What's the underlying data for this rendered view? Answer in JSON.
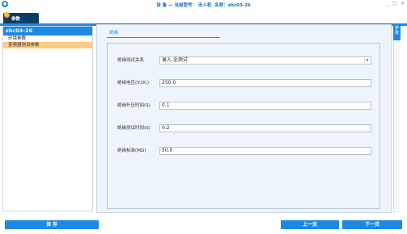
{
  "window": {
    "logo": "logo-icon",
    "title": "设 备 — 当前型号： 无人机  名称：zhc03-26",
    "controls": [
      "_",
      "□",
      "✕"
    ]
  },
  "tabs": {
    "params_label": "参数"
  },
  "sidebar": {
    "header": "zhc03-26",
    "items": [
      {
        "label": "环境参数",
        "active": false
      },
      {
        "label": "变频器测试参数",
        "active": true
      }
    ]
  },
  "main": {
    "section_title": "绝缘",
    "fields": [
      {
        "label": "绝缘测试关系",
        "value": "录入.全测试",
        "type": "select"
      },
      {
        "label": "绝缘电压(V.DC)",
        "value": "250.0",
        "type": "text"
      },
      {
        "label": "绝缘升压时间(S)",
        "value": "0.1",
        "type": "text"
      },
      {
        "label": "绝缘测试时间(S)",
        "value": "0.2",
        "type": "text"
      },
      {
        "label": "绝缘标准(MΩ)",
        "value": "50.0",
        "type": "text"
      }
    ]
  },
  "right_tab": {
    "label": "参数"
  },
  "bottom": {
    "save": "保 存",
    "prev": "上一页",
    "next": "下一页"
  },
  "colors": {
    "accent": "#1e88e5",
    "tab_dark": "#0d3b66",
    "active_item": "#ffcc80",
    "panel_bg": "#eef4fb"
  }
}
